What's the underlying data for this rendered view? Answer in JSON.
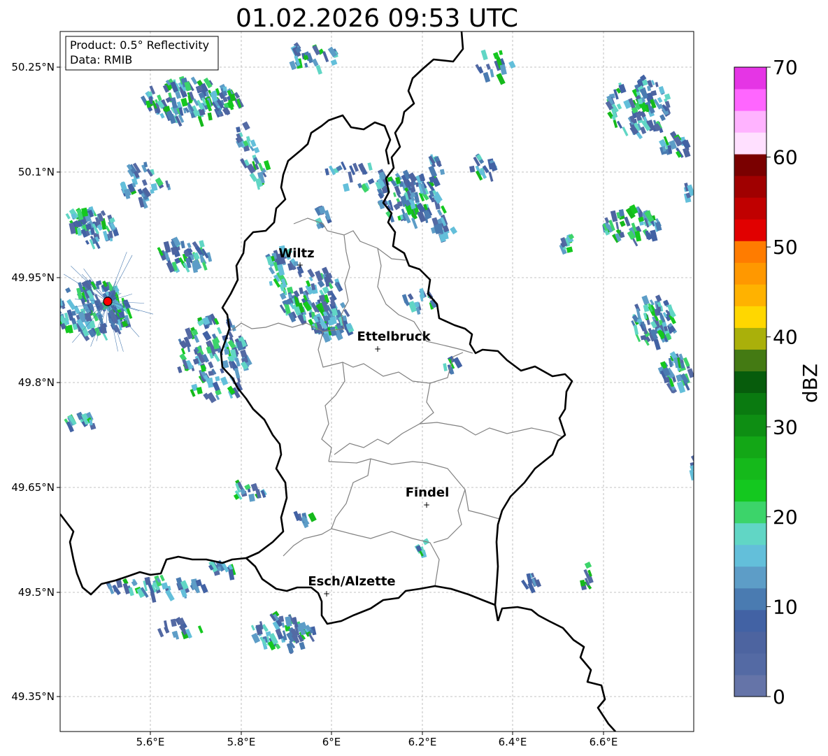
{
  "title": "01.02.2026 09:53 UTC",
  "info_box": {
    "line1": "Product: 0.5° Reflectivity",
    "line2": "Data: RMIB"
  },
  "map": {
    "lon_range": [
      5.4,
      6.8
    ],
    "lat_range": [
      49.3,
      50.3
    ],
    "x_ticks": [
      "5.6°E",
      "5.8°E",
      "6°E",
      "6.2°E",
      "6.4°E",
      "6.6°E"
    ],
    "y_ticks": [
      "50.25°N",
      "50.1°N",
      "49.95°N",
      "49.8°N",
      "49.65°N",
      "49.5°N",
      "49.35°N"
    ],
    "grid": true
  },
  "cities": [
    {
      "name": "Wiltz"
    },
    {
      "name": "Ettelbruck"
    },
    {
      "name": "Findel"
    },
    {
      "name": "Esch/Alzette"
    }
  ],
  "radar_site": {
    "color": "#ff0000"
  },
  "colorbar": {
    "label": "dBZ",
    "ticks": [
      "0",
      "10",
      "20",
      "30",
      "40",
      "50",
      "60",
      "70"
    ],
    "range": [
      0,
      70
    ],
    "colors": [
      "#6574a8",
      "#546aa4",
      "#4d64a0",
      "#4262a4",
      "#4a7bb1",
      "#5d9dc7",
      "#63bfda",
      "#61d6c5",
      "#3cd46a",
      "#14c81f",
      "#15b91b",
      "#13a716",
      "#0e8e13",
      "#0a7a10",
      "#075c0c",
      "#447a13",
      "#aab00a",
      "#ffd700",
      "#ffb200",
      "#ff9800",
      "#ff7c00",
      "#e10000",
      "#c00000",
      "#a00000",
      "#7a0000",
      "#ffe0ff",
      "#ffb3ff",
      "#ff66ff",
      "#e535e5"
    ]
  }
}
